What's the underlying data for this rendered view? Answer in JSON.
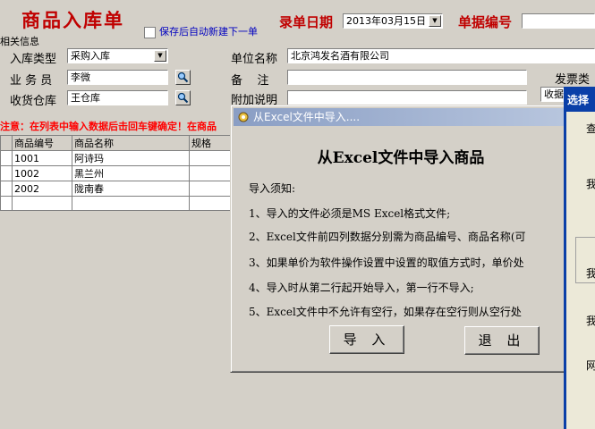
{
  "form": {
    "title": "商品入库单",
    "auto_new_label": "保存后自动新建下一单",
    "date_label": "录单日期",
    "date_value": "2013年03月15日",
    "doc_no_label": "单据编号",
    "doc_no_value": "",
    "section_label": "相关信息"
  },
  "fields": {
    "type_label": "入库类型",
    "type_value": "采购入库",
    "clerk_label": "业 务 员",
    "clerk_value": "李微",
    "warehouse_label": "收货仓库",
    "warehouse_value": "王仓库",
    "company_label": "单位名称",
    "company_value": "北京鸿发名酒有限公司",
    "remark_label": "备    注",
    "remark_value": "",
    "extra_label": "附加说明",
    "extra_value": "",
    "invoice_label": "发票类",
    "receipt_value": "收据"
  },
  "warning": "注意：在列表中输入数据后击回车键确定！在商品",
  "table": {
    "headers": [
      "商品编号",
      "商品名称",
      "规格"
    ],
    "rows": [
      [
        "1001",
        "阿诗玛",
        ""
      ],
      [
        "1002",
        "黑兰州",
        ""
      ],
      [
        "2002",
        "陇南春",
        ""
      ],
      [
        "",
        "",
        ""
      ]
    ]
  },
  "dialog": {
    "title": "从Excel文件中导入....",
    "heading": "从Excel文件中导入商品",
    "notes_title": "导入须知:",
    "notes": [
      "1、导入的文件必须是MS Excel格式文件;",
      "2、Excel文件前四列数据分别需为商品编号、商品名称(可",
      "3、如果单价为软件操作设置中设置的取值方式时，单价处",
      "4、导入时从第二行起开始导入，第一行不导入;",
      "5、Excel文件中不允许有空行，如果存在空行则从空行处"
    ],
    "import_button": "导 入",
    "exit_button": "退 出"
  },
  "side_window": {
    "title": "选择",
    "labels": [
      "查",
      "我",
      "我",
      "我",
      "网"
    ]
  },
  "colors": {
    "title_red": "#c00000",
    "warning_red": "#ff0000",
    "dialog_title": "#8a9ec4",
    "side_window": "#0a3fa8"
  }
}
